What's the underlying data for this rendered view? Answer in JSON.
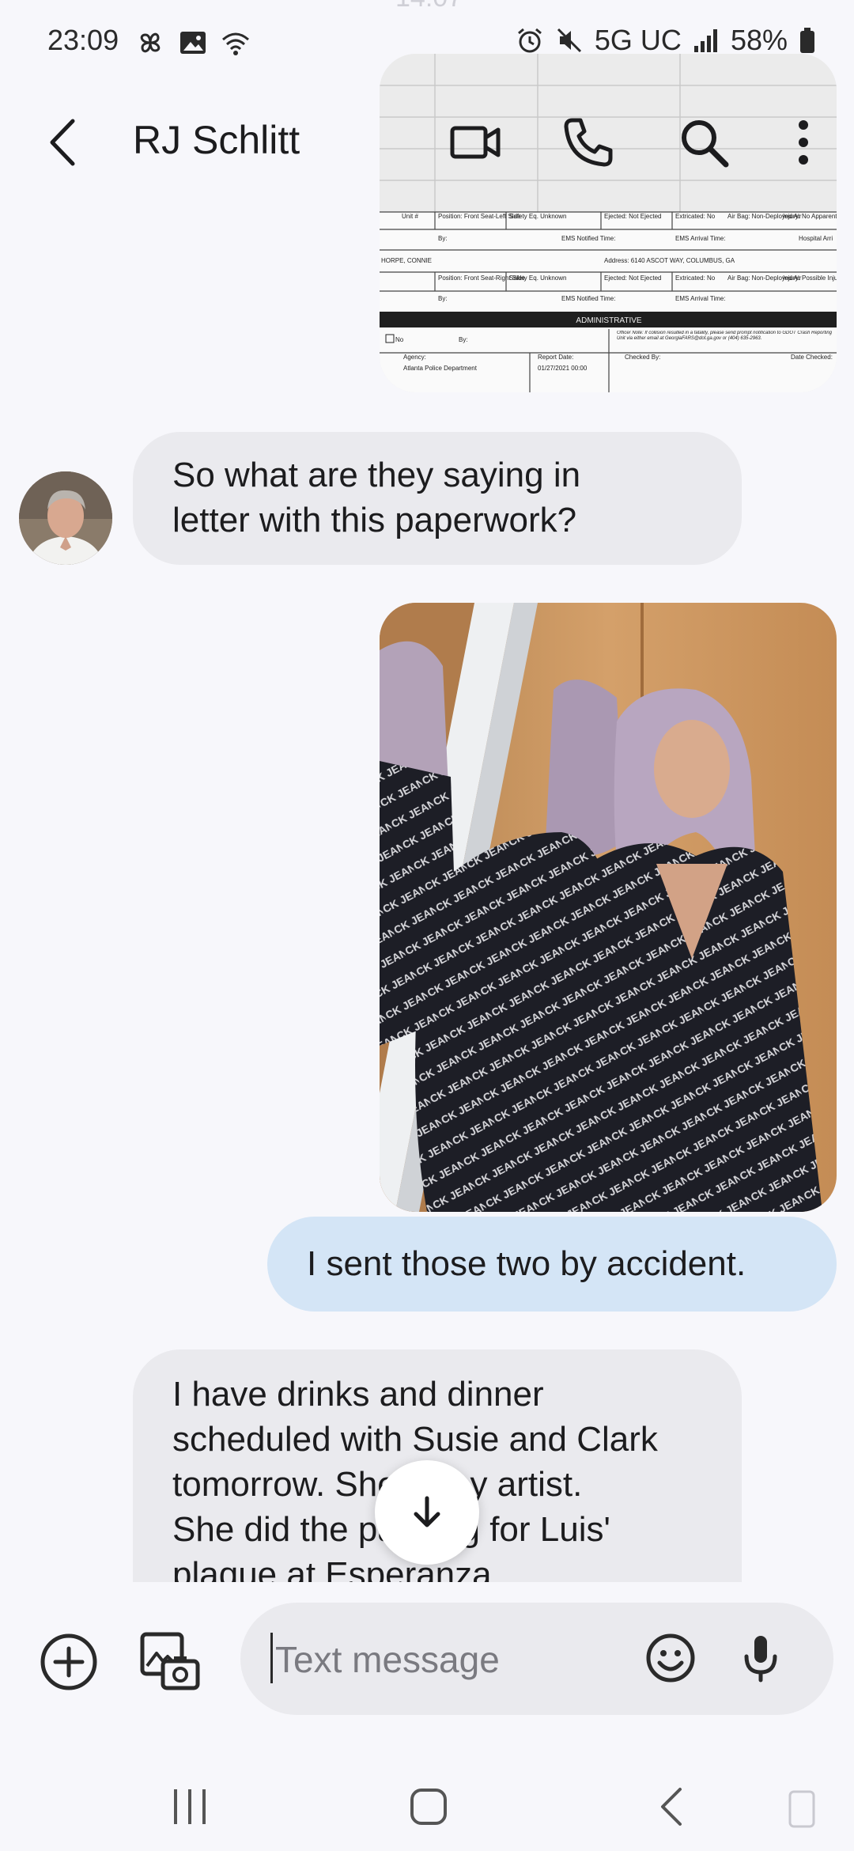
{
  "status": {
    "time": "23:09",
    "network": "5G UC",
    "battery": "58%",
    "ghost_time": "14:07"
  },
  "header": {
    "contact_name": "RJ Schlitt"
  },
  "document": {
    "row1_unit": "Unit #",
    "row1_position": "Position: Front Seat-Left Side",
    "row1_safety": "Safety Eq. Unknown",
    "row1_ejected": "Ejected: Not Ejected",
    "row1_extricated": "Extricated: No",
    "row1_airbag": "Air Bag: Non-Deployed Air",
    "row1_injury": "Injury: No Apparent Injury",
    "ems_notified": "EMS Notified Time:",
    "ems_arrival": "EMS Arrival Time:",
    "hospital": "Hospital Arri",
    "name": "HORPE, CONNIE",
    "address": "Address:   6140 ASCOT WAY, COLUMBUS, GA",
    "row2_position": "Position: Front Seat-Right Side",
    "row2_safety": "Safety Eq. Unknown",
    "row2_ejected": "Ejected: Not Ejected",
    "row2_extricated": "Extricated: No",
    "row2_airbag": "Air Bag: Non-Deployed Air",
    "row2_injury": "Injury: Possible Injury",
    "administrative": "ADMINISTRATIVE",
    "check_no": "No",
    "by": "By:",
    "agency_label": "Agency:",
    "agency": "Atlanta Police Department",
    "report_date_label": "Report Date:",
    "report_date": "01/27/2021 00:00",
    "checked_by": "Checked By:",
    "date_checked": "Date Checked:",
    "officer_note": "Officer Note: If collision resulted in a fatality, please send prompt notification to GDOT Crash Reporting Unit via either email at GeorgiaFARS@dot.ga.gov or (404) 635-2963."
  },
  "messages": {
    "incoming_1": "So what are they saying in letter with this paperwork?",
    "outgoing_1": "I sent those two by accident.",
    "incoming_2_lines": [
      "I have drinks and dinner",
      "scheduled with Susie and Clark",
      "tomorrow. She is my artist.",
      "She did the painting for Luis'",
      "plaque at Esperanza."
    ]
  },
  "photo": {
    "sweater_text": "CK CALVIN KLEIN JEANS"
  },
  "composer": {
    "placeholder": "Text message"
  }
}
